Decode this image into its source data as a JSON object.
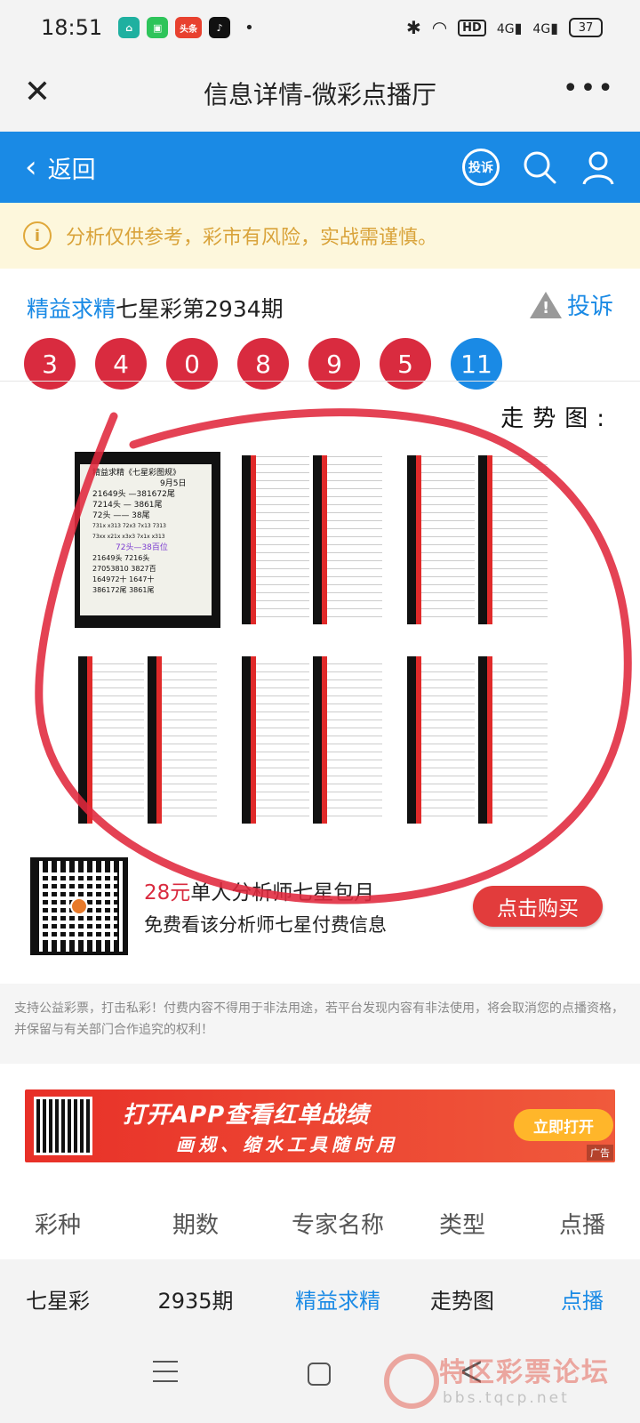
{
  "status_bar": {
    "time": "18:51",
    "apps": [
      "home-app",
      "tool-app",
      "toutiao-app",
      "tiktok-app"
    ],
    "toutiao_label": "头条",
    "dot": "•",
    "hd_label": "HD",
    "net1": "4G",
    "net2": "4G",
    "battery": "37"
  },
  "title_bar": {
    "title": "信息详情-微彩点播厅",
    "more": "•••"
  },
  "nav": {
    "back_label": "返回",
    "complain_badge": "投诉"
  },
  "notice": {
    "text": "分析仅供参考，彩市有风险，实战需谨慎。"
  },
  "headline": {
    "expert": "精益求精",
    "issue": "七星彩第2934期",
    "report_label": "投诉"
  },
  "draw_numbers": {
    "red": [
      "3",
      "4",
      "0",
      "8",
      "9",
      "5"
    ],
    "blue": "11"
  },
  "trend": {
    "label": "走势图:"
  },
  "thumb1_lines": [
    "精益求精《七星彩图规》",
    "9月5日",
    "21649头 —381672尾",
    "7214头 — 3861尾",
    "72头 —— 38尾",
    "731x x313 72x3 7x13 7313",
    "73xx x21x x3x3 7x1x x313",
    "72头—38百位",
    "21649头 7216头",
    "27053810 3827百",
    "164972十 1647十",
    "386172尾 3861尾"
  ],
  "subscription": {
    "price": "28元",
    "title": "单人分析师七星包月",
    "desc": "免费看该分析师七星付费信息",
    "buy_label": "点击购买"
  },
  "disclaimer": "支持公益彩票，打击私彩！付费内容不得用于非法用途，若平台发现内容有非法使用，将会取消您的点播资格，并保留与有关部门合作追究的权利！",
  "banner": {
    "line1": "打开APP查看红单战绩",
    "line2": "画规、缩水工具随时用",
    "open_label": "立即打开",
    "ad_tag": "广告"
  },
  "table": {
    "headers": [
      "彩种",
      "期数",
      "专家名称",
      "类型",
      "点播"
    ],
    "row": [
      "七星彩",
      "2935期",
      "精益求精",
      "走势图",
      "点播"
    ]
  },
  "watermark": {
    "text": "特区彩票论坛",
    "url": "bbs.tqcp.net"
  },
  "colors": {
    "accent_blue": "#1a8ae5",
    "ball_red": "#d92b3f",
    "notice_text": "#d9a33a",
    "annotation_red": "#e0283c"
  }
}
